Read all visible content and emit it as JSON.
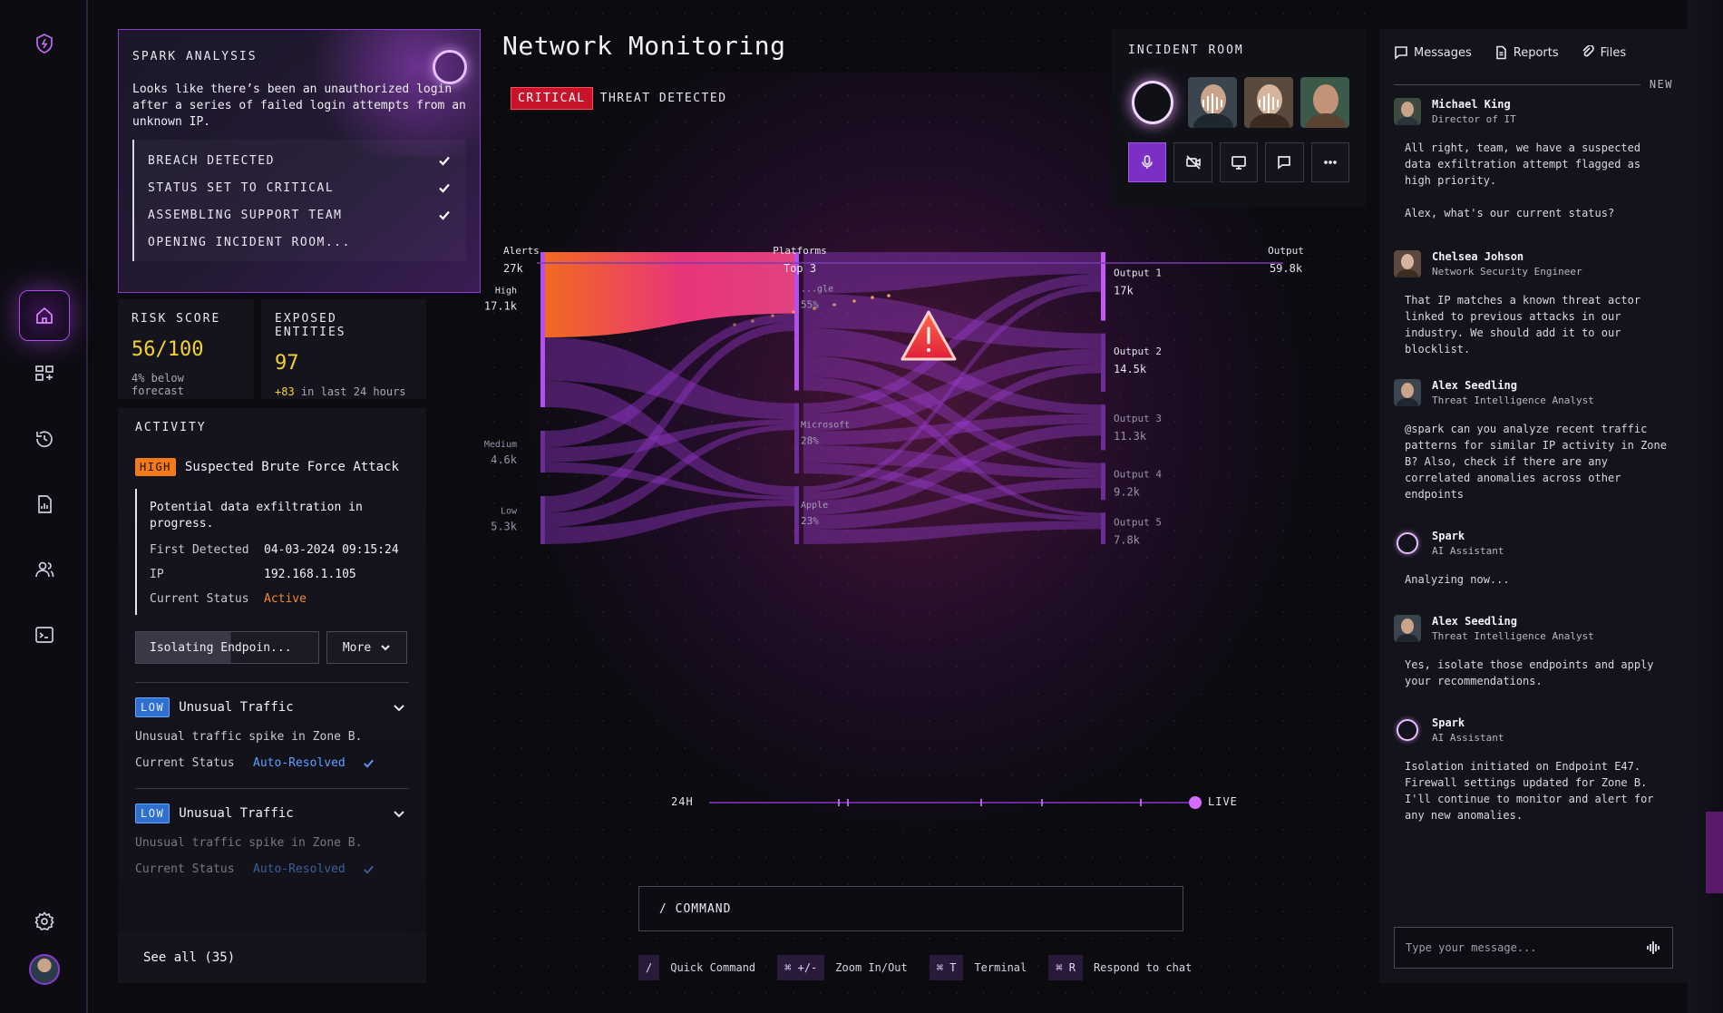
{
  "nav": {
    "items": [
      "logo",
      "home",
      "dashboard",
      "history",
      "reports",
      "users",
      "terminal",
      "settings",
      "profile"
    ]
  },
  "spark": {
    "title": "SPARK ANALYSIS",
    "text": "Looks like there’s been an unauthorized login after a series of failed login attempts from an unknown IP.",
    "steps": [
      {
        "label": "BREACH DETECTED",
        "done": true
      },
      {
        "label": "STATUS SET TO CRITICAL",
        "done": true
      },
      {
        "label": "ASSEMBLING SUPPORT TEAM",
        "done": true
      },
      {
        "label": "OPENING INCIDENT ROOM...",
        "done": false
      }
    ]
  },
  "risk": {
    "label": "RISK SCORE",
    "value": "56/100",
    "sub": "4% below forecast"
  },
  "exposed": {
    "label": "EXPOSED ENTITIES",
    "value": "97",
    "plus": "+83",
    "sub": "in last 24 hours"
  },
  "activity": {
    "title": "ACTIVITY",
    "high": {
      "badge": "HIGH",
      "title": "Suspected Brute Force Attack",
      "desc": "Potential data exfiltration in progress.",
      "fields": [
        {
          "k": "First Detected",
          "v": "04-03-2024 09:15:24"
        },
        {
          "k": "IP",
          "v": "192.168.1.105"
        },
        {
          "k": "Current Status",
          "v": "Active"
        }
      ],
      "isolate_label": "Isolating Endpoin...",
      "isolate_progress": 0.52,
      "more_label": "More"
    },
    "low_items": [
      {
        "badge": "LOW",
        "title": "Unusual Traffic",
        "desc": "Unusual traffic spike in Zone B.",
        "status_k": "Current Status",
        "status_v": "Auto-Resolved"
      },
      {
        "badge": "LOW",
        "title": "Unusual Traffic",
        "desc": "Unusual traffic spike in Zone B.",
        "status_k": "Current Status",
        "status_v": "Auto-Resolved"
      }
    ],
    "see_all": "See all (35)"
  },
  "main": {
    "title": "Network Monitoring",
    "critical": "CRITICAL",
    "threat": "THREAT DETECTED"
  },
  "chart_data": {
    "type": "sankey",
    "headers": [
      {
        "label": "Alerts",
        "value": "27k"
      },
      {
        "label": "Platforms",
        "value": "Top 3"
      },
      {
        "label": "Output",
        "value": "59.8k"
      }
    ],
    "sources": [
      {
        "name": "High",
        "value": "17.1k"
      },
      {
        "name": "Medium",
        "value": "4.6k"
      },
      {
        "name": "Low",
        "value": "5.3k"
      }
    ],
    "platforms": [
      {
        "name": "...gle",
        "value": "55%"
      },
      {
        "name": "Microsoft",
        "value": "28%"
      },
      {
        "name": "Apple",
        "value": "23%"
      }
    ],
    "outputs": [
      {
        "name": "Output 1",
        "value": "17k"
      },
      {
        "name": "Output 2",
        "value": "14.5k"
      },
      {
        "name": "Output 3",
        "value": "11.3k"
      },
      {
        "name": "Output 4",
        "value": "9.2k"
      },
      {
        "name": "Output 5",
        "value": "7.8k"
      }
    ],
    "highlight_flow": {
      "from": "High",
      "to": "...gle"
    }
  },
  "timeline": {
    "start": "24H",
    "end": "LIVE"
  },
  "command": {
    "label": "/ COMMAND"
  },
  "shortcuts": [
    {
      "key": "/",
      "label": "Quick Command"
    },
    {
      "key": "⌘ +/-",
      "label": "Zoom In/Out"
    },
    {
      "key": "⌘ T",
      "label": "Terminal"
    },
    {
      "key": "⌘ R",
      "label": "Respond to chat"
    }
  ],
  "incident": {
    "title": "INCIDENT ROOM"
  },
  "chat": {
    "tabs": [
      "Messages",
      "Reports",
      "Files"
    ],
    "new_label": "NEW",
    "messages": [
      {
        "name": "Michael King",
        "role": "Director of IT",
        "body": [
          "All right, team, we have a suspected data exfiltration attempt flagged as high priority.",
          "Alex, what's our current status?"
        ]
      },
      {
        "name": "Chelsea Johson",
        "role": "Network Security Engineer",
        "body": [
          "That IP matches a known threat actor linked to previous attacks in our industry. We should add it to our blocklist."
        ]
      },
      {
        "name": "Alex Seedling",
        "role": "Threat Intelligence Analyst",
        "body": [
          "@spark can you analyze recent traffic patterns for similar IP activity in Zone B? Also, check if there are any correlated anomalies across other endpoints"
        ]
      },
      {
        "name": "Spark",
        "role": "AI Assistant",
        "body": [
          "Analyzing now..."
        ]
      },
      {
        "name": "Alex Seedling",
        "role": "Threat Intelligence Analyst",
        "body": [
          "Yes, isolate those endpoints and apply your recommendations."
        ]
      },
      {
        "name": "Spark",
        "role": "AI Assistant",
        "body": [
          "Isolation initiated on Endpoint E47. Firewall settings updated for Zone B. I'll continue to monitor and alert for any new anomalies."
        ]
      }
    ],
    "placeholder": "Type your message..."
  },
  "colors": {
    "accent": "#b049e6",
    "critical": "#c8142a",
    "high": "#f27a1a",
    "low": "#2e6fcf",
    "warning": "#f3d232",
    "resolved": "#5aa0ff"
  }
}
